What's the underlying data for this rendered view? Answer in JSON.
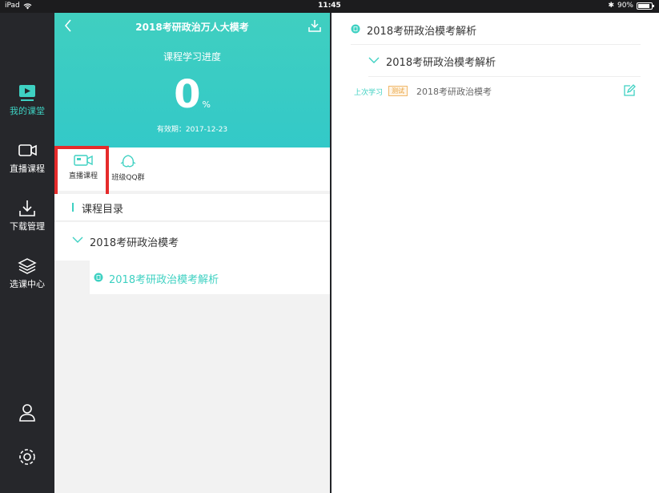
{
  "statusbar": {
    "device": "iPad",
    "time": "11:45",
    "battery": "90%"
  },
  "nav": {
    "items": [
      {
        "label": "我的课堂",
        "icon": "classroom-icon",
        "active": true
      },
      {
        "label": "直播课程",
        "icon": "video-camera-icon",
        "active": false
      },
      {
        "label": "下载管理",
        "icon": "download-icon",
        "active": false
      },
      {
        "label": "选课中心",
        "icon": "layers-icon",
        "active": false
      }
    ],
    "bottom_icons": [
      "user-icon",
      "gear-icon"
    ]
  },
  "course": {
    "title": "2018考研政治万人大模考",
    "progress_label": "课程学习进度",
    "progress_value": "0",
    "progress_unit": "%",
    "valid_until": "有效期：2017-12-23"
  },
  "toolbar": {
    "live_label": "直播课程",
    "qq_label": "班级QQ群"
  },
  "catalog": {
    "label": "课程目录",
    "chapter": "2018考研政治模考",
    "lesson": "2018考研政治模考解析"
  },
  "detail": {
    "header": "2018考研政治模考解析",
    "chapter": "2018考研政治模考解析",
    "last_label": "上次学习",
    "badge": "测试",
    "item": "2018考研政治模考"
  },
  "colors": {
    "accent": "#3ed1c2",
    "highlight": "#e52b2b",
    "nav_bg": "#26272b"
  }
}
